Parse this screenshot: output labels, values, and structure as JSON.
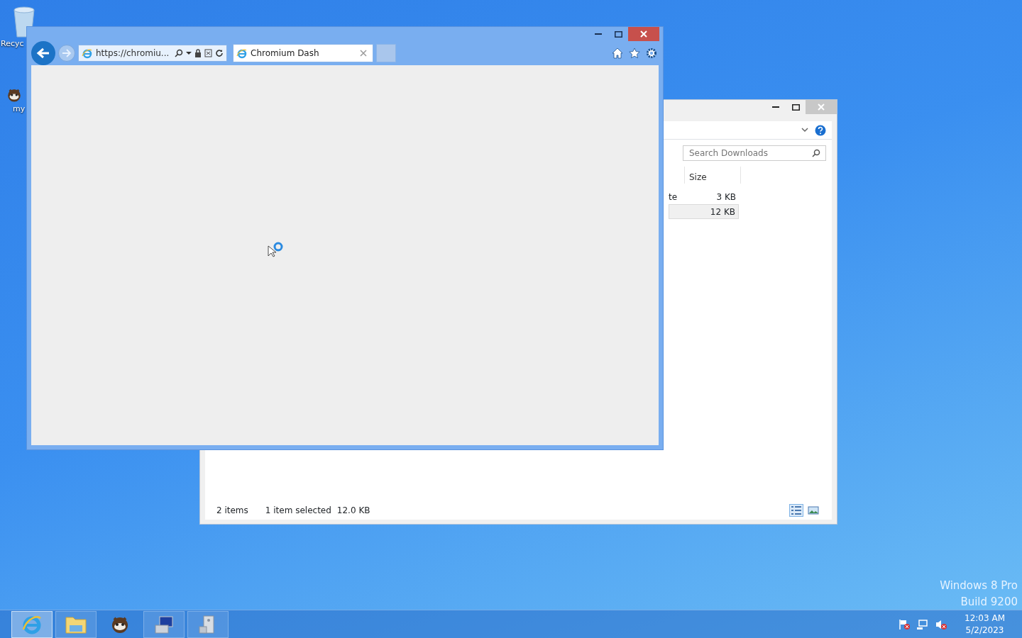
{
  "desktop_icons": [
    {
      "kind": "bin",
      "label": "Recyc"
    },
    {
      "kind": "raccoon",
      "label": "my"
    }
  ],
  "browser": {
    "address": "https://chromiu...",
    "loading": true,
    "tabs": [
      {
        "label": "Chromium Dash",
        "selected": true
      }
    ]
  },
  "explorer": {
    "search": {
      "placeholder": "Search Downloads"
    },
    "columns": [
      "Size"
    ],
    "rows": [
      {
        "column_1": "te",
        "size": "3 KB",
        "selected": false
      },
      {
        "size": "12 KB",
        "selected": true
      }
    ],
    "status": {
      "count": "2 items",
      "selection": "1 item selected",
      "selection_size": "12.0 KB"
    },
    "views": [
      {
        "kind": "details",
        "selected": true
      },
      {
        "kind": "tiles",
        "selected": false
      }
    ]
  },
  "edition": {
    "lines": [
      "Windows 8 Pro",
      "Build 9200"
    ]
  },
  "taskbar": {
    "apps": [
      {
        "kind": "ie",
        "selected": true
      },
      {
        "kind": "folder",
        "selected": false
      },
      {
        "kind": "raccoon",
        "selected": false
      },
      {
        "kind": "computer",
        "selected": false
      },
      {
        "kind": "server",
        "selected": false
      }
    ],
    "clock": {
      "time": "12:03 AM",
      "date": "5/2/2023"
    }
  }
}
